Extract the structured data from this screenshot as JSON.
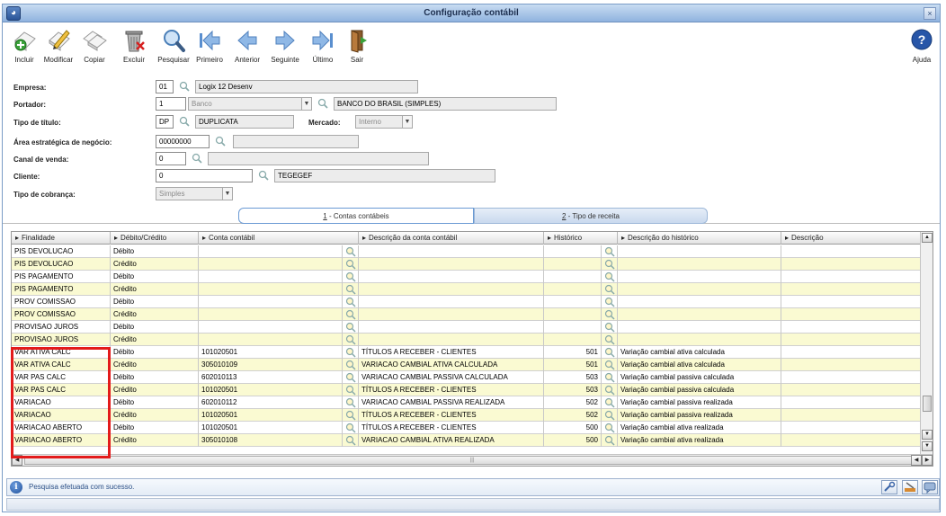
{
  "window": {
    "title": "Configuração contábil",
    "close_label": "×"
  },
  "toolbar": {
    "items": [
      {
        "label": "Incluir",
        "icon": "add-document-icon"
      },
      {
        "label": "Modificar",
        "icon": "edit-document-icon"
      },
      {
        "label": "Copiar",
        "icon": "copy-document-icon"
      },
      {
        "label": "Excluir",
        "icon": "trash-icon"
      },
      {
        "label": "Pesquisar",
        "icon": "magnifier-icon"
      },
      {
        "label": "Primeiro",
        "icon": "first-arrow-icon"
      },
      {
        "label": "Anterior",
        "icon": "previous-arrow-icon"
      },
      {
        "label": "Seguinte",
        "icon": "next-arrow-icon"
      },
      {
        "label": "Último",
        "icon": "last-arrow-icon"
      },
      {
        "label": "Sair",
        "icon": "exit-door-icon"
      }
    ],
    "help_label": "Ajuda"
  },
  "form": {
    "empresa": {
      "label": "Empresa:",
      "code": "01",
      "desc": "Logix 12 Desenv"
    },
    "portador": {
      "label": "Portador:",
      "code": "1",
      "type": "Banco",
      "desc": "BANCO DO BRASIL (SIMPLES)"
    },
    "tipo_titulo": {
      "label": "Tipo de título:",
      "code": "DP",
      "desc": "DUPLICATA"
    },
    "mercado": {
      "label": "Mercado:",
      "value": "Interno"
    },
    "area": {
      "label": "Área estratégica de negócio:",
      "code": "00000000",
      "desc": ""
    },
    "canal": {
      "label": "Canal de venda:",
      "code": "0",
      "desc": ""
    },
    "cliente": {
      "label": "Cliente:",
      "code": "0",
      "desc": "TEGEGEF"
    },
    "tipo_cobranca": {
      "label": "Tipo de cobrança:",
      "value": "Simples"
    }
  },
  "tabs": [
    {
      "num": "1",
      "label": " - Contas contábeis",
      "active": true
    },
    {
      "num": "2",
      "label": " - Tipo de receita",
      "active": false
    }
  ],
  "grid": {
    "columns": [
      "Finalidade",
      "Débito/Crédito",
      "Conta contábil",
      "Descrição da conta contábil",
      "Histórico",
      "Descrição do histórico",
      "Descrição"
    ],
    "rows": [
      {
        "finalidade": "PIS DEVOLUCAO",
        "dc": "Débito",
        "conta": "",
        "desc_conta": "",
        "hist": "",
        "desc_hist": "",
        "desc": ""
      },
      {
        "finalidade": "PIS DEVOLUCAO",
        "dc": "Crédito",
        "conta": "",
        "desc_conta": "",
        "hist": "",
        "desc_hist": "",
        "desc": ""
      },
      {
        "finalidade": "PIS PAGAMENTO",
        "dc": "Débito",
        "conta": "",
        "desc_conta": "",
        "hist": "",
        "desc_hist": "",
        "desc": ""
      },
      {
        "finalidade": "PIS PAGAMENTO",
        "dc": "Crédito",
        "conta": "",
        "desc_conta": "",
        "hist": "",
        "desc_hist": "",
        "desc": ""
      },
      {
        "finalidade": "PROV COMISSAO",
        "dc": "Débito",
        "conta": "",
        "desc_conta": "",
        "hist": "",
        "desc_hist": "",
        "desc": ""
      },
      {
        "finalidade": "PROV COMISSAO",
        "dc": "Crédito",
        "conta": "",
        "desc_conta": "",
        "hist": "",
        "desc_hist": "",
        "desc": ""
      },
      {
        "finalidade": "PROVISAO JUROS",
        "dc": "Débito",
        "conta": "",
        "desc_conta": "",
        "hist": "",
        "desc_hist": "",
        "desc": ""
      },
      {
        "finalidade": "PROVISAO JUROS",
        "dc": "Crédito",
        "conta": "",
        "desc_conta": "",
        "hist": "",
        "desc_hist": "",
        "desc": ""
      },
      {
        "finalidade": "VAR ATIVA CALC",
        "dc": "Débito",
        "conta": "101020501",
        "desc_conta": "TÍTULOS A RECEBER - CLIENTES",
        "hist": "501",
        "desc_hist": "Variação cambial ativa calculada",
        "desc": ""
      },
      {
        "finalidade": "VAR ATIVA CALC",
        "dc": "Crédito",
        "conta": "305010109",
        "desc_conta": "VARIACAO CAMBIAL ATIVA CALCULADA",
        "hist": "501",
        "desc_hist": "Variação cambial ativa calculada",
        "desc": ""
      },
      {
        "finalidade": "VAR PAS CALC",
        "dc": "Débito",
        "conta": "602010113",
        "desc_conta": "VARIACAO CAMBIAL PASSIVA CALCULADA",
        "hist": "503",
        "desc_hist": "Variação cambial passiva calculada",
        "desc": ""
      },
      {
        "finalidade": "VAR PAS CALC",
        "dc": "Crédito",
        "conta": "101020501",
        "desc_conta": "TÍTULOS A RECEBER - CLIENTES",
        "hist": "503",
        "desc_hist": "Variação cambial passiva calculada",
        "desc": ""
      },
      {
        "finalidade": "VARIACAO",
        "dc": "Débito",
        "conta": "602010112",
        "desc_conta": "VARIACAO CAMBIAL PASSIVA REALIZADA",
        "hist": "502",
        "desc_hist": "Variação cambial passiva realizada",
        "desc": ""
      },
      {
        "finalidade": "VARIACAO",
        "dc": "Crédito",
        "conta": "101020501",
        "desc_conta": "TÍTULOS A RECEBER - CLIENTES",
        "hist": "502",
        "desc_hist": "Variação cambial passiva realizada",
        "desc": ""
      },
      {
        "finalidade": "VARIACAO ABERTO",
        "dc": "Débito",
        "conta": "101020501",
        "desc_conta": "TÍTULOS A RECEBER - CLIENTES",
        "hist": "500",
        "desc_hist": "Variação cambial ativa realizada",
        "desc": ""
      },
      {
        "finalidade": "VARIACAO ABERTO",
        "dc": "Crédito",
        "conta": "305010108",
        "desc_conta": "VARIACAO CAMBIAL ATIVA REALIZADA",
        "hist": "500",
        "desc_hist": "Variação cambial ativa realizada",
        "desc": ""
      }
    ]
  },
  "status": {
    "message": "Pesquisa efetuada com sucesso."
  },
  "colors": {
    "accent": "#2b5597",
    "row_alt": "#fafad2",
    "highlight": "#e31b1b"
  }
}
